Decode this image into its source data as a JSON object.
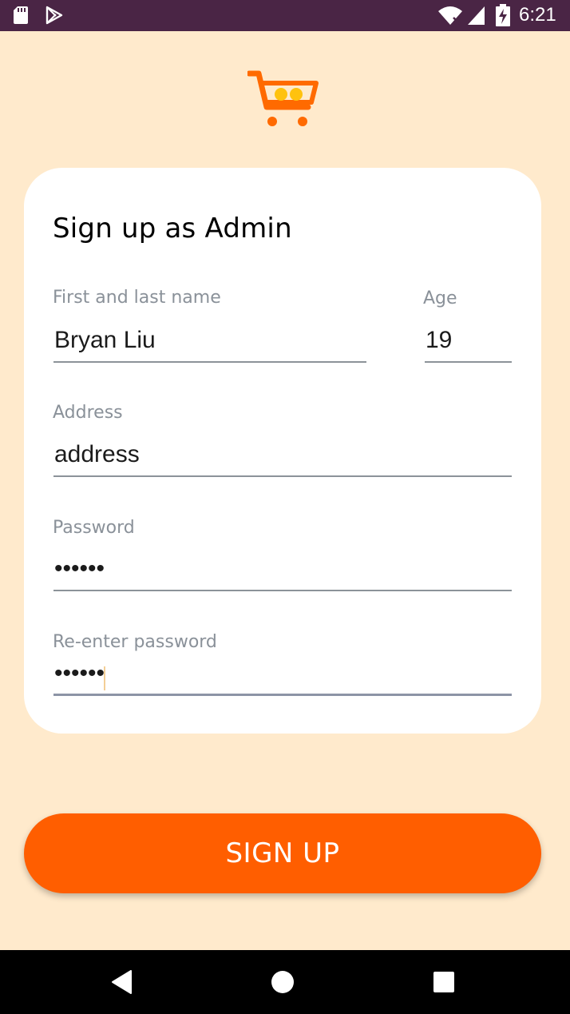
{
  "status_bar": {
    "time": "6:21",
    "icons": [
      "sd-card-icon",
      "play-store-icon",
      "wifi-icon",
      "signal-icon",
      "battery-charging-icon"
    ]
  },
  "logo": {
    "icon": "shopping-cart-icon",
    "color": "#ff6a00"
  },
  "form": {
    "title": "Sign up as Admin",
    "name": {
      "label": "First and last name",
      "value": "Bryan Liu"
    },
    "age": {
      "label": "Age",
      "value": "19"
    },
    "address": {
      "label": "Address",
      "value": "address"
    },
    "password": {
      "label": "Password",
      "value": "••••••"
    },
    "reenter_password": {
      "label": "Re-enter password",
      "value": "••••••"
    }
  },
  "signup_button": {
    "label": "SIGN UP",
    "color": "#ff5e00"
  },
  "nav_bar": {
    "icons": [
      "back-icon",
      "home-icon",
      "recents-icon"
    ]
  },
  "colors": {
    "background": "#ffeacc",
    "status_bar": "#4a2545",
    "accent": "#ff5e00"
  }
}
